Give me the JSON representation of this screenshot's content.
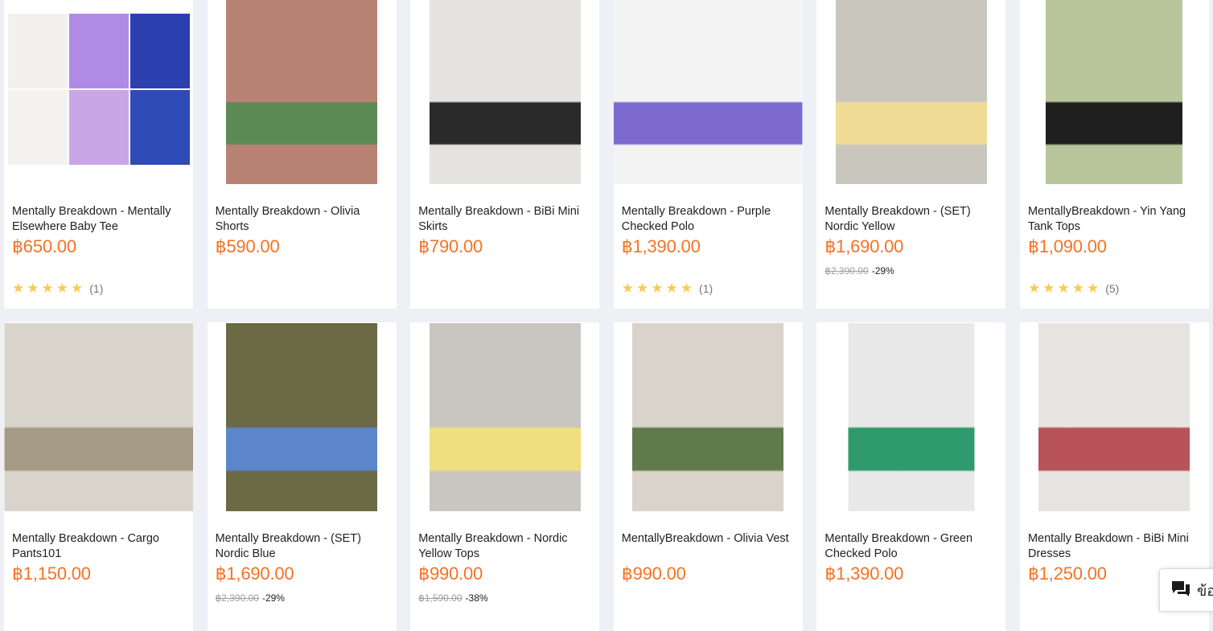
{
  "products": [
    {
      "title": "Mentally Breakdown - Mentally Elsewhere Baby Tee",
      "price": "฿650.00",
      "original": "",
      "discount": "",
      "stars": 5,
      "reviews": "(1)",
      "bg": "#f4f4f4",
      "accent": "#8a65d6"
    },
    {
      "title": "Mentally Breakdown - Olivia Shorts",
      "price": "฿590.00",
      "original": "",
      "discount": "",
      "stars": 0,
      "reviews": "",
      "bg": "#b88374",
      "accent": "#5b8a55"
    },
    {
      "title": "Mentally Breakdown - BiBi Mini Skirts",
      "price": "฿790.00",
      "original": "",
      "discount": "",
      "stars": 0,
      "reviews": "",
      "bg": "#e4e3df",
      "accent": "#2a2a2a"
    },
    {
      "title": "Mentally Breakdown - Purple Checked Polo",
      "price": "฿1,390.00",
      "original": "",
      "discount": "",
      "stars": 5,
      "reviews": "(1)",
      "bg": "#f3f3f3",
      "accent": "#7d6ad0"
    },
    {
      "title": "Mentally Breakdown - (SET) Nordic Yellow",
      "price": "฿1,690.00",
      "original": "฿2,390.00",
      "discount": "-29%",
      "stars": 0,
      "reviews": "",
      "bg": "#c9c6bd",
      "accent": "#f1dc96"
    },
    {
      "title": "MentallyBreakdown - Yin Yang Tank Tops",
      "price": "฿1,090.00",
      "original": "",
      "discount": "",
      "stars": 5,
      "reviews": "(5)",
      "bg": "#b8c59a",
      "accent": "#1f1f1f"
    },
    {
      "title": "Mentally Breakdown - Cargo Pants101",
      "price": "฿1,150.00",
      "original": "",
      "discount": "",
      "stars": 0,
      "reviews": "",
      "bg": "#d8d4cc",
      "accent": "#a59a86"
    },
    {
      "title": "Mentally Breakdown - (SET) Nordic Blue",
      "price": "฿1,690.00",
      "original": "฿2,390.00",
      "discount": "-29%",
      "stars": 0,
      "reviews": "",
      "bg": "#6c6a45",
      "accent": "#5b86cc"
    },
    {
      "title": "Mentally Breakdown - Nordic Yellow Tops",
      "price": "฿990.00",
      "original": "฿1,590.00",
      "discount": "-38%",
      "stars": 0,
      "reviews": "",
      "bg": "#c9c6c2",
      "accent": "#f0df7e"
    },
    {
      "title": "MentallyBreakdown - Olivia Vest",
      "price": "฿990.00",
      "original": "",
      "discount": "",
      "stars": 0,
      "reviews": "",
      "bg": "#d9d3cb",
      "accent": "#5f7a4b"
    },
    {
      "title": "Mentally Breakdown - Green Checked Polo",
      "price": "฿1,390.00",
      "original": "",
      "discount": "",
      "stars": 0,
      "reviews": "",
      "bg": "#e8e8e8",
      "accent": "#2f9a6b"
    },
    {
      "title": "Mentally Breakdown - BiBi Mini Dresses",
      "price": "฿1,250.00",
      "original": "",
      "discount": "",
      "stars": 0,
      "reviews": "",
      "bg": "#e6e4e0",
      "accent": "#b8535a"
    }
  ],
  "chat": {
    "label": "ข้อ",
    "icon": "chat-bubbles-icon"
  },
  "colors": {
    "price": "#f57224",
    "star": "#faca51",
    "background": "#eff0f5"
  }
}
